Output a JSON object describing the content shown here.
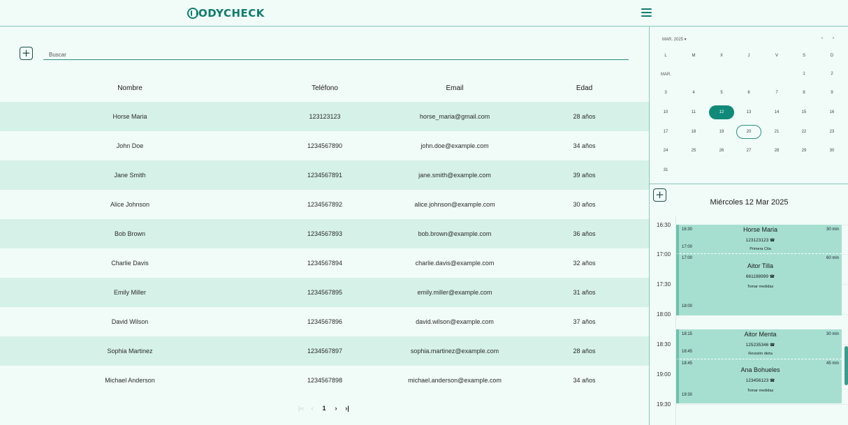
{
  "header": {
    "logo_text": "ODYCHECK",
    "logo_icon": "b-ring-logo-icon",
    "menu_icon": "hamburger-menu-icon"
  },
  "search": {
    "placeholder": "Buscar",
    "add_label": "+"
  },
  "table": {
    "columns": [
      "Nombre",
      "Teléfono",
      "Email",
      "Edad"
    ],
    "rows": [
      [
        "Horse Maria",
        "123123123",
        "horse_maria@gmail.com",
        "28 años"
      ],
      [
        "John Doe",
        "1234567890",
        "john.doe@example.com",
        "34 años"
      ],
      [
        "Jane Smith",
        "1234567891",
        "jane.smith@example.com",
        "39 años"
      ],
      [
        "Alice Johnson",
        "1234567892",
        "alice.johnson@example.com",
        "30 años"
      ],
      [
        "Bob Brown",
        "1234567893",
        "bob.brown@example.com",
        "36 años"
      ],
      [
        "Charlie Davis",
        "1234567894",
        "charlie.davis@example.com",
        "32 años"
      ],
      [
        "Emily Miller",
        "1234567895",
        "emily.miller@example.com",
        "31 años"
      ],
      [
        "David Wilson",
        "1234567896",
        "david.wilson@example.com",
        "37 años"
      ],
      [
        "Sophia Martinez",
        "1234567897",
        "sophia.martinez@example.com",
        "28 años"
      ],
      [
        "Michael Anderson",
        "1234567898",
        "michael.anderson@example.com",
        "34 años"
      ]
    ]
  },
  "pagination": {
    "first": "|‹‹",
    "prev": "‹",
    "page": "1",
    "next": "›",
    "last": "›|"
  },
  "calendar": {
    "month_label": "MAR. 2025 ▾",
    "prev": "‹",
    "next": "›",
    "weekdays": [
      "L",
      "M",
      "X",
      "J",
      "V",
      "S",
      "D"
    ],
    "row_label": "MAR.",
    "selected_day": "12",
    "today_day": "20",
    "weeks": [
      [
        "",
        "",
        "",
        "",
        "",
        "1",
        "2"
      ],
      [
        "3",
        "4",
        "5",
        "6",
        "7",
        "8",
        "9"
      ],
      [
        "10",
        "11",
        "12",
        "13",
        "14",
        "15",
        "16"
      ],
      [
        "17",
        "18",
        "19",
        "20",
        "21",
        "22",
        "23"
      ],
      [
        "24",
        "25",
        "26",
        "27",
        "28",
        "29",
        "30"
      ],
      [
        "31",
        "",
        "",
        "",
        "",
        "",
        ""
      ]
    ]
  },
  "agenda": {
    "add_label": "+",
    "date_title": "Miércoles 12 Mar 2025",
    "hours": [
      "16:30",
      "17:00",
      "17:30",
      "18:00",
      "18:30",
      "19:00",
      "19:30"
    ],
    "appointments": [
      {
        "start": "16:30",
        "end": "17:00",
        "name": "Horse Maria",
        "phone": "123123123",
        "note": "Primera Cita",
        "duration": "30 min"
      },
      {
        "start": "17:00",
        "end": "18:00",
        "name": "Aitor Tilla",
        "phone": "661198999",
        "note": "Tomar medidas",
        "duration": "60 min"
      },
      {
        "start": "18:15",
        "end": "18:45",
        "name": "Aitor Menta",
        "phone": "125235346",
        "note": "Revisión dieta",
        "duration": "30 min"
      },
      {
        "start": "18:45",
        "end": "19:30",
        "name": "Ana Bohueles",
        "phone": "123456123",
        "note": "Tomar medidas",
        "duration": "45 min"
      }
    ]
  }
}
